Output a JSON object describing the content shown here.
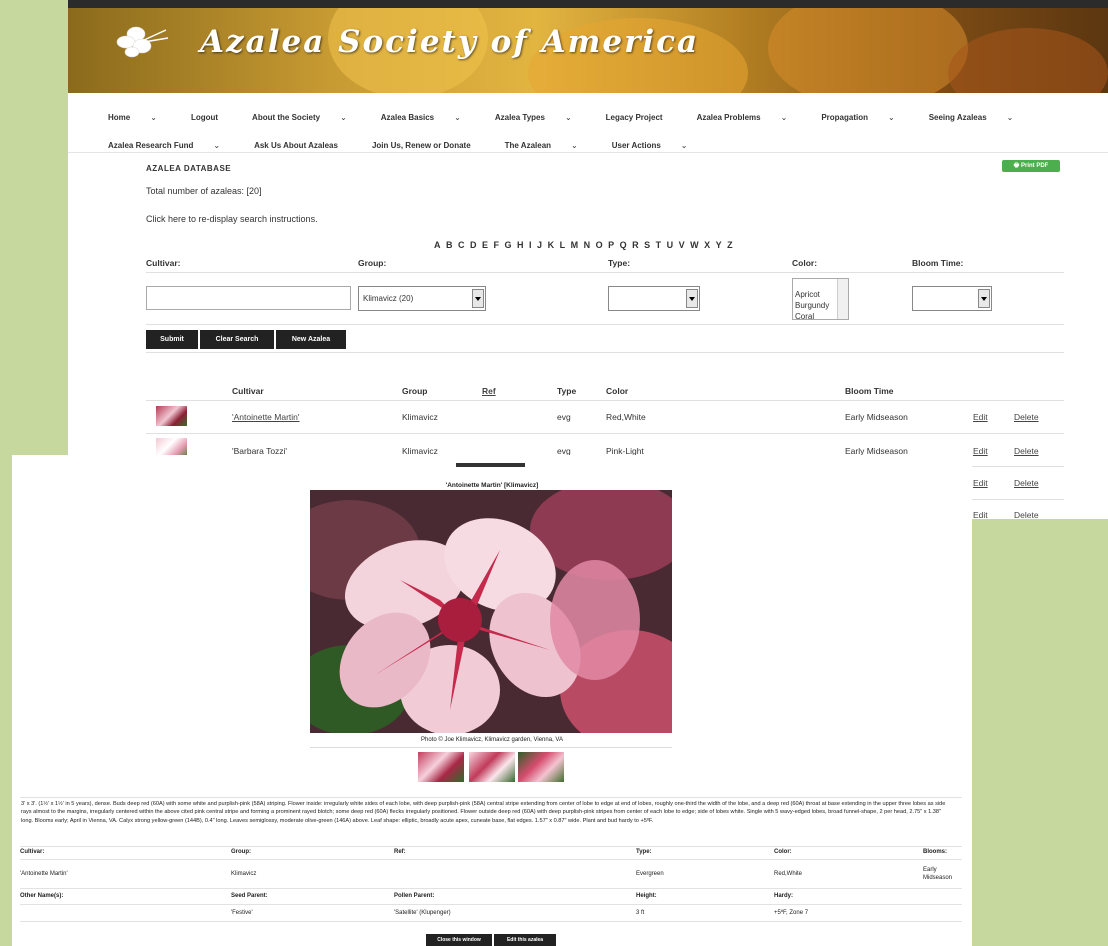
{
  "site": {
    "title": "Azalea Society of America"
  },
  "nav": [
    {
      "label": "Home",
      "dropdown": true
    },
    {
      "label": "Logout",
      "dropdown": false
    },
    {
      "label": "About the Society",
      "dropdown": true
    },
    {
      "label": "Azalea Basics",
      "dropdown": true
    },
    {
      "label": "Azalea Types",
      "dropdown": true
    },
    {
      "label": "Legacy Project",
      "dropdown": false
    },
    {
      "label": "Azalea Problems",
      "dropdown": true
    },
    {
      "label": "Propagation",
      "dropdown": true
    },
    {
      "label": "Seeing Azaleas",
      "dropdown": true
    },
    {
      "label": "Azalea Research Fund",
      "dropdown": true
    },
    {
      "label": "Ask Us About Azaleas",
      "dropdown": false
    },
    {
      "label": "Join Us, Renew or Donate",
      "dropdown": false
    },
    {
      "label": "The Azalean",
      "dropdown": true
    },
    {
      "label": "User Actions",
      "dropdown": true
    }
  ],
  "database": {
    "title": "AZALEA DATABASE",
    "print_label": "Print  PDF",
    "total": "Total number of azaleas: [20]",
    "redisplay": "Click here to re-display search instructions.",
    "alphabet": [
      "A",
      "B",
      "C",
      "D",
      "E",
      "F",
      "G",
      "H",
      "I",
      "J",
      "K",
      "L",
      "M",
      "N",
      "O",
      "P",
      "Q",
      "R",
      "S",
      "T",
      "U",
      "V",
      "W",
      "X",
      "Y",
      "Z"
    ]
  },
  "search": {
    "cultivar_label": "Cultivar:",
    "group_label": "Group:",
    "type_label": "Type:",
    "color_label": "Color:",
    "bloom_label": "Bloom Time:",
    "cultivar_value": "",
    "group_value": "Klimavicz (20)",
    "type_value": "",
    "bloom_value": "",
    "color_options": [
      "Apricot",
      "Burgundy",
      "Coral"
    ],
    "submit": "Submit",
    "clear": "Clear Search",
    "new": "New Azalea"
  },
  "table": {
    "headers": {
      "cultivar": "Cultivar",
      "group": "Group",
      "ref": "Ref",
      "type": "Type",
      "color": "Color",
      "bloom": "Bloom Time"
    },
    "rows": [
      {
        "cultivar": "'Antoinette Martin'",
        "group": "Klimavicz",
        "type": "evg",
        "color": "Red,White",
        "bloom": "Early Midseason",
        "edit": "Edit",
        "delete": "Delete"
      },
      {
        "cultivar": "'Barbara Tozzi'",
        "group": "Klimavicz",
        "type": "evg",
        "color": "Pink-Light",
        "bloom": "Early Midseason",
        "edit": "Edit",
        "delete": "Delete"
      }
    ],
    "extra_rows": [
      {
        "edit": "Edit",
        "delete": "Delete"
      },
      {
        "edit": "Edit",
        "delete": "Delete"
      }
    ]
  },
  "popup": {
    "title": "'Antoinette Martin' [Klimavicz]",
    "caption": "Photo © Joe Klimavicz, Klimavicz garden, Vienna, VA",
    "description": "3' x 3'. (1½' x 1½' in 5 years), dense. Buds deep red (60A) with some white and purplish-pink (58A) striping. Flower inside: irregularly white sides of each lobe, with deep purplish-pink (58A) central stripe extending from center of lobe to edge at end of lobes, roughly one-third the width of the lobe, and a deep red (60A) throat at base extending in the upper three lobes as side rays almost to the margins, irregularly centered within the above cited pink central stripe and forming a prominent rayed blotch; some deep red (60A) flecks irregularly positioned. Flower outside deep red (60A) with deep purplish-pink stripes from center of each lobe to edge; side of lobes white. Single with 5 wavy-edged lobes, broad funnel-shape, 2 per head, 2.75\" x 1.38\" long. Blooms early; April in Vienna, VA. Calyx strong yellow-green (144B), 0.4\" long. Leaves semiglossy, moderate olive-green (146A) above. Leaf shape: elliptic, broadly acute apex, cuneate base, flat edges. 1.57\" x 0.87\" wide. Plant and bud hardy to +5ºF.",
    "labels": {
      "cultivar": "Cultivar:",
      "group": "Group:",
      "ref": "Ref:",
      "type": "Type:",
      "color": "Color:",
      "blooms": "Blooms:",
      "other": "Other Name(s):",
      "seed": "Seed Parent:",
      "pollen": "Pollen Parent:",
      "height": "Height:",
      "hardy": "Hardy:"
    },
    "values": {
      "cultivar": "'Antoinette Martin'",
      "group": "Klimavicz",
      "ref": "",
      "type": "Evergreen",
      "color": "Red,White",
      "blooms": "Early Midseason",
      "other": "",
      "seed": "'Festive'",
      "pollen": "'Satellite' (Klupenger)",
      "height": "3 ft",
      "hardy": "+5ºF, Zone 7"
    },
    "close_button": "Close this window",
    "edit_button": "Edit this azalea"
  }
}
